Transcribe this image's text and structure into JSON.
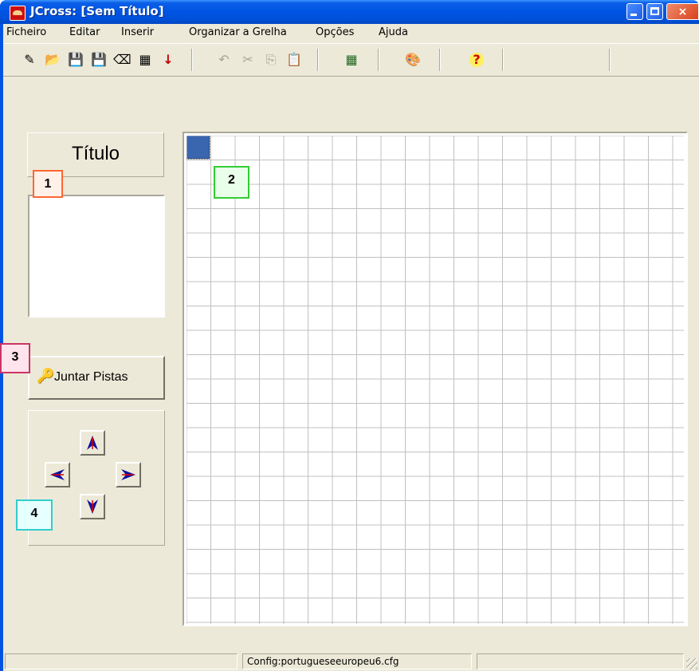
{
  "window": {
    "title": "JCross: [Sem Título]",
    "controls": {
      "minimize": "minimize",
      "maximize": "maximize",
      "close": "×"
    }
  },
  "menu": [
    "Ficheiro",
    "Editar",
    "Inserir",
    "Organizar a Grelha",
    "Opções",
    "Ajuda"
  ],
  "toolbar": {
    "buttons": [
      {
        "icon": "new-file-icon",
        "glyph": "✎",
        "enabled": true
      },
      {
        "icon": "open-folder-icon",
        "glyph": "📂",
        "enabled": true
      },
      {
        "icon": "save-icon",
        "glyph": "💾",
        "enabled": true
      },
      {
        "icon": "save-as-icon",
        "glyph": "💾",
        "enabled": true
      },
      {
        "icon": "eraser-icon",
        "glyph": "⌫",
        "enabled": true
      },
      {
        "icon": "web-export-icon",
        "glyph": "▦",
        "enabled": true
      },
      {
        "icon": "down-arrow-icon",
        "glyph": "↓",
        "enabled": true
      },
      {
        "icon": "undo-icon",
        "glyph": "↶",
        "enabled": false
      },
      {
        "icon": "cut-icon",
        "glyph": "✂",
        "enabled": false
      },
      {
        "icon": "copy-icon",
        "glyph": "⎘",
        "enabled": false
      },
      {
        "icon": "paste-icon",
        "glyph": "📋",
        "enabled": false
      },
      {
        "icon": "grid-icon",
        "glyph": "▦",
        "enabled": true
      },
      {
        "icon": "colors-icon",
        "glyph": "🎨",
        "enabled": true
      },
      {
        "icon": "help-icon",
        "glyph": "?",
        "enabled": true
      }
    ]
  },
  "left_panel": {
    "title_button": "Título",
    "title_text": "",
    "join_button": "Juntar Pistas"
  },
  "grid": {
    "columns": 20,
    "rows": 20,
    "selected_cell": [
      1,
      1
    ],
    "selected_color": "#3a66b0",
    "line_color": "#c0c0c0"
  },
  "callouts": [
    {
      "label": "1",
      "color": "#ff6633"
    },
    {
      "label": "2",
      "color": "#33cc33"
    },
    {
      "label": "3",
      "color": "#cc3366"
    },
    {
      "label": "4",
      "color": "#33cccc"
    }
  ],
  "statusbar": {
    "left": "",
    "config": "Config:portugueseeuropeu6.cfg",
    "right": ""
  },
  "colors": {
    "titlebar": "#0055e5",
    "face": "#ece9d8",
    "accent": "#0054e3"
  }
}
